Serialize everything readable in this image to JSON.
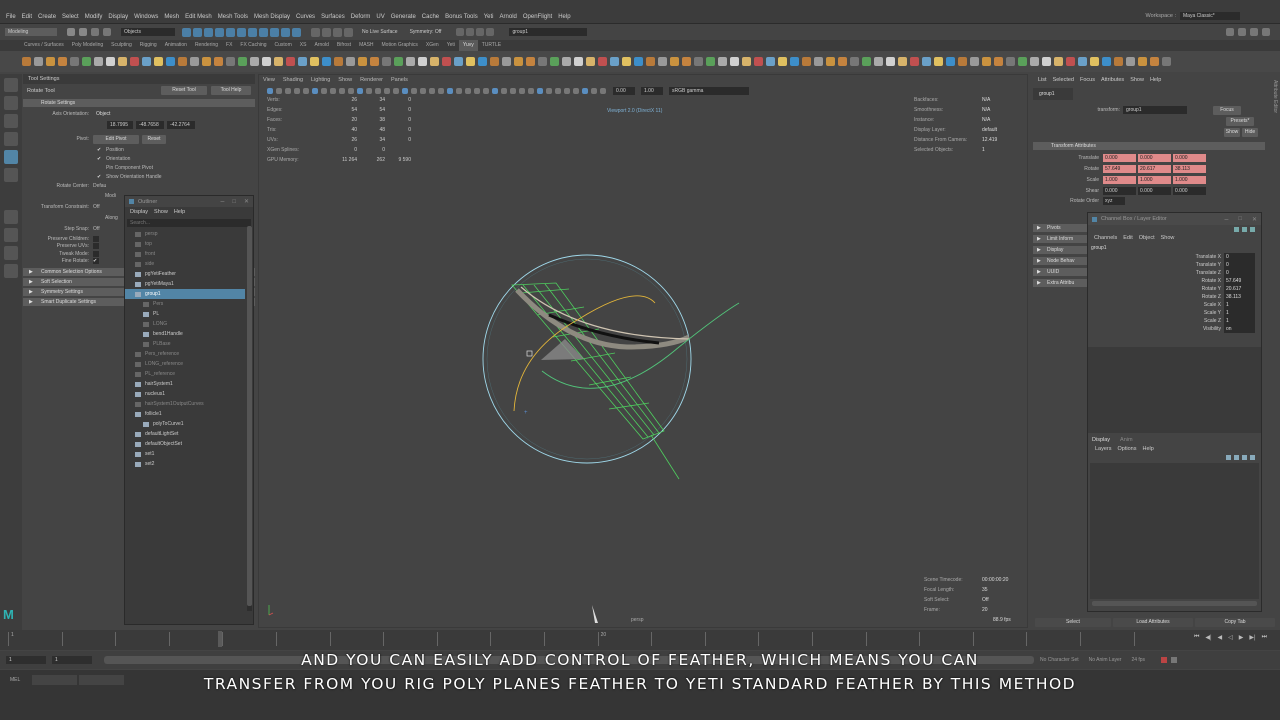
{
  "menubar": {
    "items": [
      "File",
      "Edit",
      "Create",
      "Select",
      "Modify",
      "Display",
      "Windows",
      "Mesh",
      "Edit Mesh",
      "Mesh Tools",
      "Mesh Display",
      "Curves",
      "Surfaces",
      "Deform",
      "UV",
      "Generate",
      "Cache",
      "Bonus Tools",
      "Yeti",
      "Arnold",
      "OpenFlight",
      "Help"
    ],
    "workspace_label": "Workspace :",
    "workspace_value": "Maya Classic*"
  },
  "statusline": {
    "mode": "Modeling",
    "objects": "Objects",
    "live_surface": "No Live Surface",
    "symmetry": "Symmetry: Off",
    "name_field": "group1"
  },
  "shelf_tabs": {
    "items": [
      "Curves / Surfaces",
      "Poly Modeling",
      "Sculpting",
      "Rigging",
      "Animation",
      "Rendering",
      "FX",
      "FX Caching",
      "Custom",
      "XS",
      "Arnold",
      "Bifrost",
      "MASH",
      "Motion Graphics",
      "XGen",
      "Yeti",
      "Yuvy",
      "TURTLE"
    ],
    "active": "Yuvy"
  },
  "tool_settings": {
    "title": "Tool Settings",
    "tool_name": "Rotate Tool",
    "reset_tool": "Reset Tool",
    "tool_help": "Tool Help",
    "section": "Rotate Settings",
    "axis_orientation_label": "Axis Orientation:",
    "axis_orientation_value": "Object",
    "axis_values": [
      "18.7995",
      "-48.7658",
      "-42.2764"
    ],
    "pivot_label": "Pivot:",
    "edit_pivot": "Edit Pivot",
    "reset": "Reset",
    "pivot_checks": [
      "Position",
      "Orientation",
      "Pin Component Pivot",
      "Show Orientation Handle"
    ],
    "rotate_center_label": "Rotate Center:",
    "rotate_center_values": [
      "Defau",
      "Modi"
    ],
    "transform_constraint_label": "Transform Constraint:",
    "transform_constraint_value": "Off",
    "along_label": "Along",
    "step_snap_label": "Step Snap:",
    "step_snap_value": "Off",
    "opts": [
      "Preserve Children:",
      "Preserve UVs:",
      "Tweak Mode:",
      "Fine Rotate:"
    ],
    "frames": [
      "Common Selection Options",
      "Soft Selection",
      "Symmetry Settings",
      "Smart Duplicate Settings"
    ]
  },
  "outliner": {
    "title": "Outliner",
    "menus": [
      "Display",
      "Show",
      "Help"
    ],
    "search_placeholder": "Search...",
    "items": [
      {
        "label": "persp",
        "style": "dim",
        "indent": 0
      },
      {
        "label": "top",
        "style": "dim",
        "indent": 0
      },
      {
        "label": "front",
        "style": "dim",
        "indent": 0
      },
      {
        "label": "side",
        "style": "dim",
        "indent": 0
      },
      {
        "label": "pgYetiFeather",
        "style": "",
        "indent": 0
      },
      {
        "label": "pgYetiMaya1",
        "style": "",
        "indent": 0
      },
      {
        "label": "group1",
        "style": "sel",
        "indent": 0
      },
      {
        "label": "Pers",
        "style": "dim",
        "indent": 1
      },
      {
        "label": "PL",
        "style": "",
        "indent": 1
      },
      {
        "label": "LONG",
        "style": "dim",
        "indent": 1
      },
      {
        "label": "bend1Handle",
        "style": "",
        "indent": 1
      },
      {
        "label": "PLBase",
        "style": "dim",
        "indent": 1
      },
      {
        "label": "Pers_reference",
        "style": "dim",
        "indent": 0
      },
      {
        "label": "LONG_reference",
        "style": "dim",
        "indent": 0
      },
      {
        "label": "PL_reference",
        "style": "dim",
        "indent": 0
      },
      {
        "label": "hairSystem1",
        "style": "",
        "indent": 0
      },
      {
        "label": "nucleus1",
        "style": "",
        "indent": 0
      },
      {
        "label": "hairSystem1OutputCurves",
        "style": "dim",
        "indent": 0
      },
      {
        "label": "follicle1",
        "style": "",
        "indent": 0
      },
      {
        "label": "polyToCurve1",
        "style": "",
        "indent": 1
      },
      {
        "label": "defaultLightSet",
        "style": "",
        "indent": 0
      },
      {
        "label": "defaultObjectSet",
        "style": "",
        "indent": 0
      },
      {
        "label": "set1",
        "style": "",
        "indent": 0
      },
      {
        "label": "set2",
        "style": "",
        "indent": 0
      }
    ]
  },
  "viewport": {
    "menus": [
      "View",
      "Shading",
      "Lighting",
      "Show",
      "Renderer",
      "Panels"
    ],
    "field_a": "0.00",
    "field_b": "1.00",
    "color_space": "sRGB gamma",
    "renderer_label": "Viewport 2.0 (DirectX 11)",
    "hud_left": [
      {
        "k": "Verts:",
        "a": "26",
        "b": "34",
        "c": "0"
      },
      {
        "k": "Edges:",
        "a": "54",
        "b": "54",
        "c": "0"
      },
      {
        "k": "Faces:",
        "a": "20",
        "b": "38",
        "c": "0"
      },
      {
        "k": "Tris:",
        "a": "40",
        "b": "48",
        "c": "0"
      },
      {
        "k": "UVs:",
        "a": "26",
        "b": "34",
        "c": "0"
      },
      {
        "k": "XGen Splines:",
        "a": "0",
        "b": "0",
        "c": ""
      },
      {
        "k": "GPU Memory:",
        "a": "11 264",
        "b": "262",
        "c": "9 590"
      }
    ],
    "hud_right": [
      {
        "k": "Backfaces:",
        "v": "N/A"
      },
      {
        "k": "Smoothness:",
        "v": "N/A"
      },
      {
        "k": "Instance:",
        "v": "N/A"
      },
      {
        "k": "Display Layer:",
        "v": "default"
      },
      {
        "k": "Distance From Camera:",
        "v": "12.419"
      },
      {
        "k": "Selected Objects:",
        "v": "1"
      }
    ],
    "hud_bottom": [
      {
        "k": "Scene Timecode:",
        "v": "00:00:00:20"
      },
      {
        "k": "Focal Length:",
        "v": "35"
      },
      {
        "k": "Soft Select:",
        "v": "Off"
      },
      {
        "k": "Frame:",
        "v": "20"
      }
    ],
    "fps": "88.9 fps",
    "camera": "persp"
  },
  "attribute_editor": {
    "menus": [
      "List",
      "Selected",
      "Focus",
      "Attributes",
      "Show",
      "Help"
    ],
    "node_tab": "group1",
    "transform_label": "transform:",
    "transform_value": "group1",
    "focus": "Focus",
    "presets": "Presets*",
    "show": "Show",
    "hide": "Hide",
    "section": "Transform Attributes",
    "rows": [
      {
        "label": "Translate",
        "vals": [
          "0.000",
          "0.000",
          "0.000"
        ],
        "style": "red"
      },
      {
        "label": "Rotate",
        "vals": [
          "57.649",
          "20.617",
          "38.113"
        ],
        "style": "red"
      },
      {
        "label": "Scale",
        "vals": [
          "1.000",
          "1.000",
          "1.000"
        ],
        "style": "red"
      },
      {
        "label": "Shear",
        "vals": [
          "0.000",
          "0.000",
          "0.000"
        ],
        "style": "dark"
      }
    ],
    "rotate_order_label": "Rotate Order",
    "rotate_order_value": "xyz",
    "sections": [
      "Pivots",
      "Limit Inform",
      "Display",
      "Node Behav",
      "UUID",
      "Extra Attribu"
    ],
    "buttons": [
      "Select",
      "Load Attributes",
      "Copy Tab"
    ],
    "side_tab": "Attribute Editor"
  },
  "channel_box": {
    "title": "Channel Box / Layer Editor",
    "menus": [
      "Channels",
      "Edit",
      "Object",
      "Show"
    ],
    "node": "group1",
    "channels": [
      {
        "n": "Translate X",
        "v": "0"
      },
      {
        "n": "Translate Y",
        "v": "0"
      },
      {
        "n": "Translate Z",
        "v": "0"
      },
      {
        "n": "Rotate X",
        "v": "57.649"
      },
      {
        "n": "Rotate Y",
        "v": "20.617"
      },
      {
        "n": "Rotate Z",
        "v": "38.113"
      },
      {
        "n": "Scale X",
        "v": "1"
      },
      {
        "n": "Scale Y",
        "v": "1"
      },
      {
        "n": "Scale Z",
        "v": "1"
      },
      {
        "n": "Visibility",
        "v": "on"
      }
    ],
    "layer_tabs": [
      "Display",
      "Anim"
    ],
    "layer_menus": [
      "Layers",
      "Options",
      "Help"
    ]
  },
  "timeline": {
    "ticks": [
      "1",
      "",
      "",
      "",
      "",
      "",
      "",
      "",
      "",
      "",
      "",
      "20",
      "",
      "",
      "",
      "",
      "",
      "",
      "",
      "",
      "",
      ""
    ],
    "current_frame": "20",
    "range_start": "1",
    "range_end": "1",
    "char_set": "No Character Set",
    "anim_layer": "No Anim Layer",
    "fps": "24 fps",
    "cmd_label": "MEL"
  },
  "subtitles": {
    "line1": "AND YOU CAN EASILY ADD CONTROL OF FEATHER, WHICH MEANS YOU CAN",
    "line2": "TRANSFER FROM YOU RIG POLY PLANES FEATHER TO YETI STANDARD FEATHER BY THIS METHOD"
  }
}
